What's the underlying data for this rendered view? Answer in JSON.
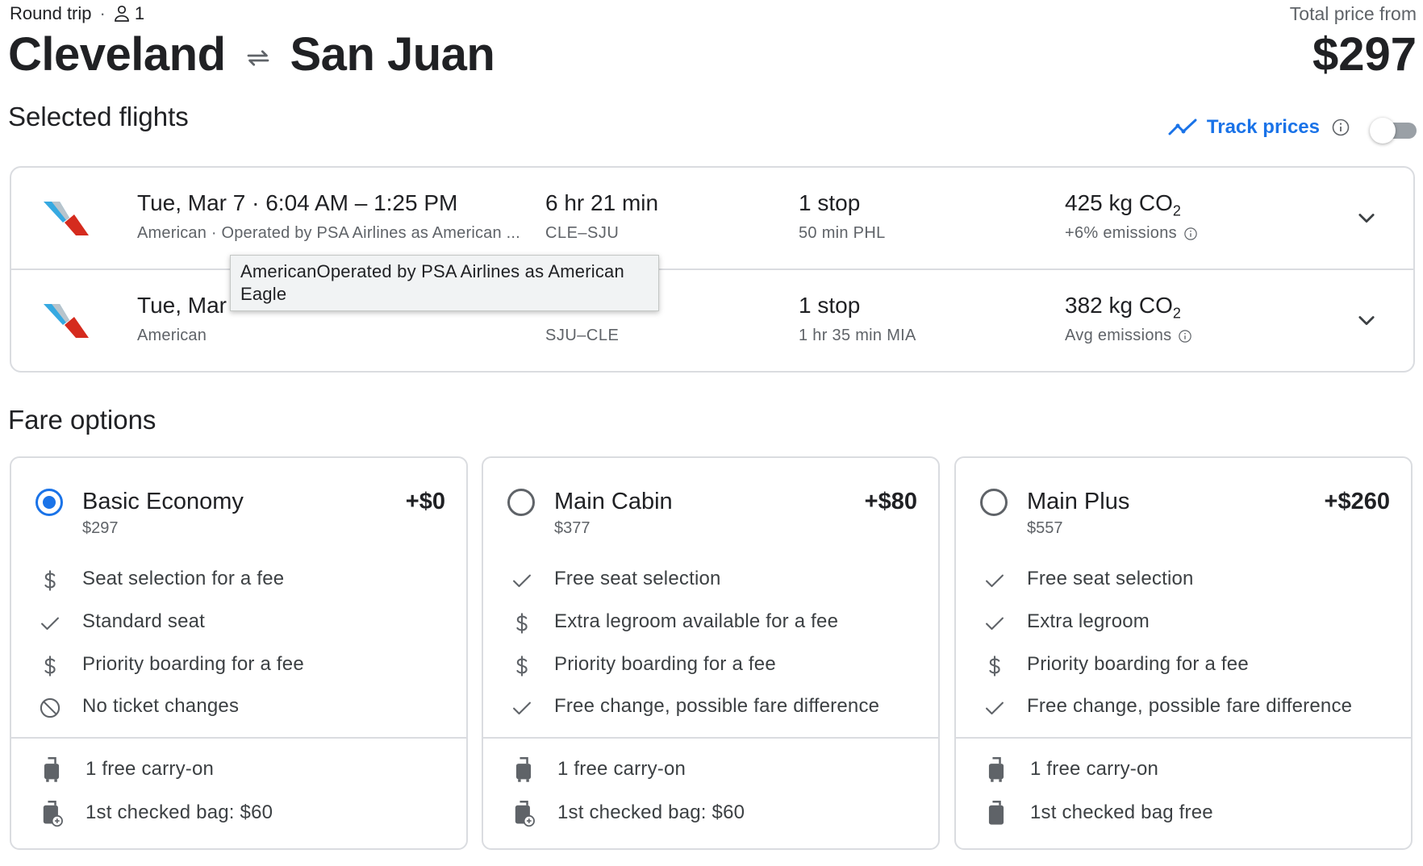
{
  "header": {
    "trip_type": "Round trip",
    "separator": "·",
    "passengers": "1",
    "origin": "Cleveland",
    "destination": "San Juan",
    "total_label": "Total price from",
    "total_price": "$297"
  },
  "selected_flights": {
    "title": "Selected flights",
    "track_prices_label": "Track prices",
    "track_prices_enabled": false,
    "flights": [
      {
        "date_time": "Tue, Mar 7 · 6:04 AM – 1:25 PM",
        "airline": "American · Operated by PSA Airlines as American ...",
        "duration": "6 hr 21 min",
        "route": "CLE–SJU",
        "stops": "1 stop",
        "layover": "50 min PHL",
        "co2_value": "425 kg CO",
        "co2_sub": "2",
        "emissions": "+6% emissions"
      },
      {
        "date_time": "Tue, Mar",
        "airline": "American",
        "duration": "",
        "route": "SJU–CLE",
        "stops": "1 stop",
        "layover": "1 hr 35 min MIA",
        "co2_value": "382 kg CO",
        "co2_sub": "2",
        "emissions": "Avg emissions"
      }
    ],
    "tooltip": "AmericanOperated by PSA Airlines as American Eagle"
  },
  "fare_options": {
    "title": "Fare options",
    "fares": [
      {
        "name": "Basic Economy",
        "base_price": "$297",
        "delta": "+$0",
        "selected": true,
        "features": [
          {
            "icon": "dollar-icon",
            "text": "Seat selection for a fee"
          },
          {
            "icon": "check-icon",
            "text": "Standard seat"
          },
          {
            "icon": "dollar-icon",
            "text": "Priority boarding for a fee"
          },
          {
            "icon": "no-entry-icon",
            "text": "No ticket changes"
          }
        ],
        "bags": [
          {
            "icon": "carry-on-icon",
            "text": "1 free carry-on"
          },
          {
            "icon": "checked-bag-fee-icon",
            "text": "1st checked bag: $60"
          }
        ]
      },
      {
        "name": "Main Cabin",
        "base_price": "$377",
        "delta": "+$80",
        "selected": false,
        "features": [
          {
            "icon": "check-icon",
            "text": "Free seat selection"
          },
          {
            "icon": "dollar-icon",
            "text": "Extra legroom available for a fee"
          },
          {
            "icon": "dollar-icon",
            "text": "Priority boarding for a fee"
          },
          {
            "icon": "check-icon",
            "text": "Free change, possible fare difference"
          }
        ],
        "bags": [
          {
            "icon": "carry-on-icon",
            "text": "1 free carry-on"
          },
          {
            "icon": "checked-bag-fee-icon",
            "text": "1st checked bag: $60"
          }
        ]
      },
      {
        "name": "Main Plus",
        "base_price": "$557",
        "delta": "+$260",
        "selected": false,
        "features": [
          {
            "icon": "check-icon",
            "text": "Free seat selection"
          },
          {
            "icon": "check-icon",
            "text": "Extra legroom"
          },
          {
            "icon": "dollar-icon",
            "text": "Priority boarding for a fee"
          },
          {
            "icon": "check-icon",
            "text": "Free change, possible fare difference"
          }
        ],
        "bags": [
          {
            "icon": "carry-on-icon",
            "text": "1 free carry-on"
          },
          {
            "icon": "checked-bag-icon",
            "text": "1st checked bag free"
          }
        ]
      }
    ]
  },
  "colors": {
    "accent": "#1a73e8",
    "text_primary": "#202124",
    "text_secondary": "#5f6368",
    "border": "#dadce0",
    "logo_blue": "#36a9e1",
    "logo_red": "#d52b1e"
  }
}
